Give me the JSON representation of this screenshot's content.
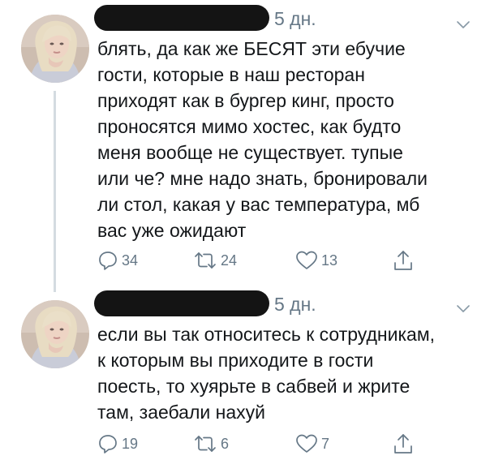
{
  "tweets": [
    {
      "timestamp": "5 дн.",
      "text": "блять, да как же БЕСЯТ эти ебучие\nгости, которые в наш ресторан\nприходят как в бургер кинг, просто\nпроносятся мимо хостес, как будто\nменя вообще не существует. тупые\nили че? мне надо знать, бронировали\nли стол, какая у вас температура, мб\nвас уже ожидают",
      "reply_count": "34",
      "retweet_count": "24",
      "like_count": "13"
    },
    {
      "timestamp": "5 дн.",
      "text": "если вы так относитесь к сотрудникам,\nк которым вы приходите в гости\nпоесть, то хуярьте в сабвей и жрите\nтам, заебали нахуй",
      "reply_count": "19",
      "retweet_count": "6",
      "like_count": "7"
    }
  ],
  "icons": {
    "reply": "reply-icon",
    "retweet": "retweet-icon",
    "like": "heart-icon",
    "share": "share-icon",
    "caret": "chevron-down-icon"
  },
  "colors": {
    "text": "#14171a",
    "secondary": "#657786",
    "thread_line": "#d4dbe1",
    "redaction": "#141414"
  }
}
